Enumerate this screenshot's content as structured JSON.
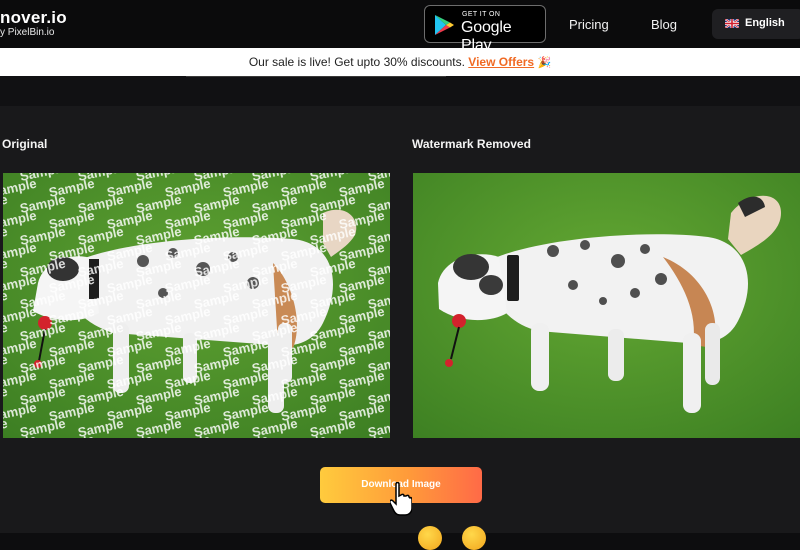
{
  "header": {
    "logo_title": "nover.io",
    "logo_subtitle": "y PixelBin.io",
    "google_play": {
      "small_text": "GET IT ON",
      "big_text": "Google Play"
    },
    "nav": {
      "pricing": "Pricing",
      "blog": "Blog"
    },
    "language": {
      "label": "English",
      "flag_icon": "uk-flag-icon"
    }
  },
  "banner": {
    "text": "Our sale is live! Get upto 30% discounts.",
    "link": "View Offers",
    "emoji": "🎉"
  },
  "comparison": {
    "original_title": "Original",
    "removed_title": "Watermark Removed",
    "watermark_word": "Sample"
  },
  "actions": {
    "download_label": "Download Image"
  },
  "colors": {
    "accent": "#f06a24",
    "button_gradient_start": "#ffcb3d",
    "button_gradient_end": "#ff6a47",
    "background": "#19191b"
  },
  "icons": [
    "google-play-icon",
    "uk-flag-icon",
    "party-popper-icon",
    "hand-pointer-icon"
  ]
}
